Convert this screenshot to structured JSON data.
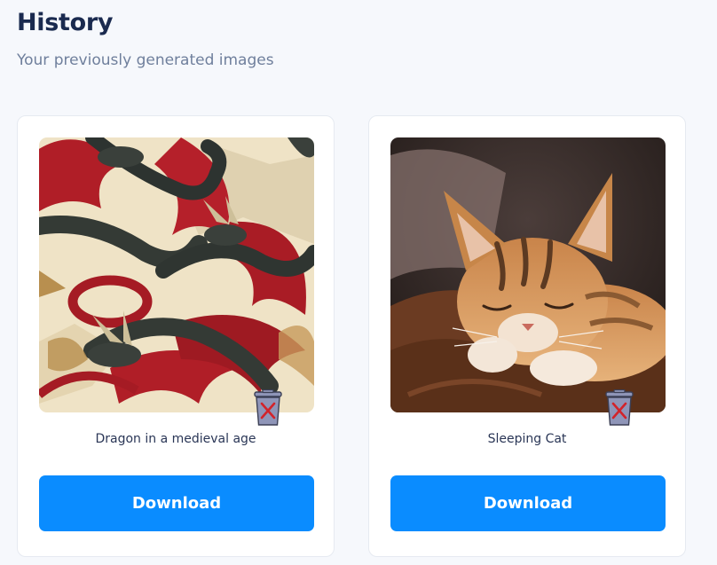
{
  "header": {
    "title": "History",
    "subtitle": "Your previously generated images"
  },
  "items": [
    {
      "caption": "Dragon in a medieval age",
      "download_label": "Download",
      "image": "dragon-pattern-image",
      "delete_icon": "trash-icon"
    },
    {
      "caption": "Sleeping Cat",
      "download_label": "Download",
      "image": "sleeping-cat-image",
      "delete_icon": "trash-icon"
    }
  ],
  "colors": {
    "accent": "#0a8cff",
    "background": "#f6f8fc",
    "title": "#1a2a4f",
    "subtitle": "#6f7f9c"
  }
}
